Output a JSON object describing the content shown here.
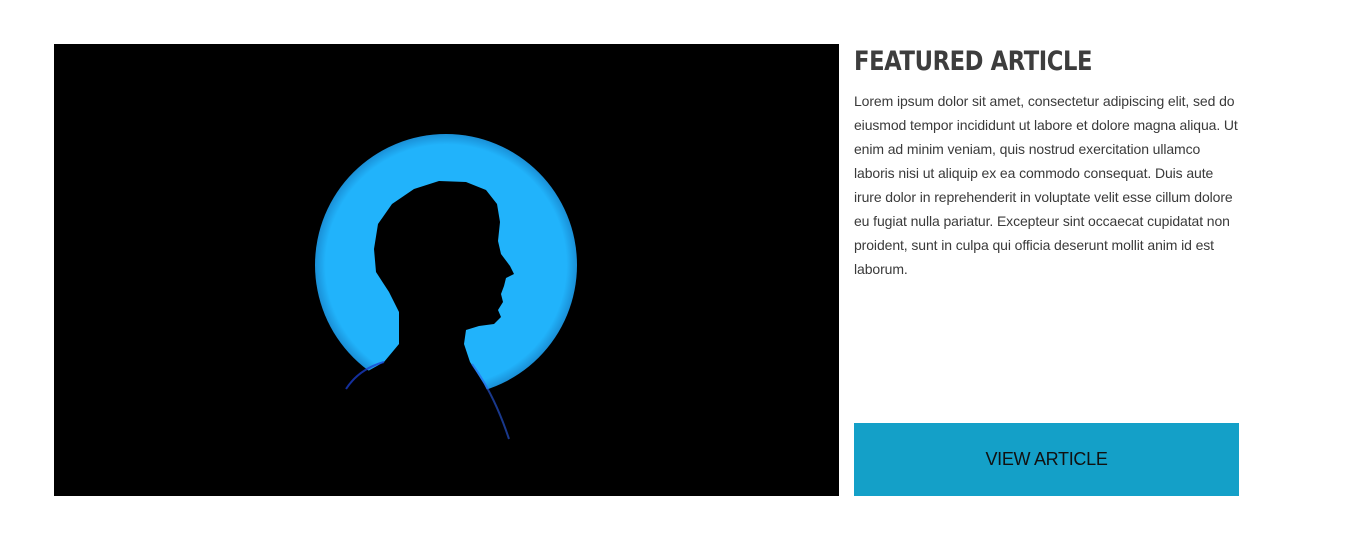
{
  "featured": {
    "title": "FEATURED ARTICLE",
    "body": "Lorem ipsum dolor sit amet, consectetur adipiscing elit, sed do eiusmod tempor incididunt ut labore et dolore magna aliqua. Ut enim ad minim veniam, quis nostrud exercitation ullamco laboris nisi ut aliquip ex ea commodo consequat. Duis aute irure dolor in reprehenderit in voluptate velit esse cillum dolore eu fugiat nulla pariatur. Excepteur sint occaecat cupidatat non proident, sunt in culpa qui officia deserunt mollit anim id est laborum.",
    "button_label": "VIEW ARTICLE"
  },
  "colors": {
    "button_bg": "#14a0c8",
    "halo": "#21b3fb",
    "image_bg": "#000000",
    "title": "#3d3d3d"
  }
}
